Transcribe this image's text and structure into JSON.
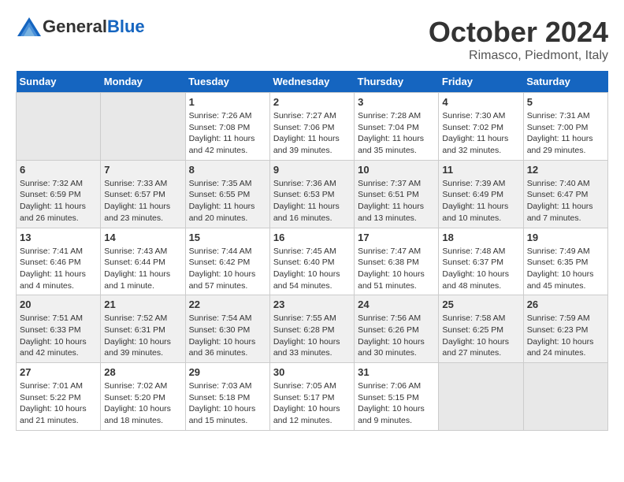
{
  "header": {
    "logo_line1": "General",
    "logo_line2": "Blue",
    "month": "October 2024",
    "location": "Rimasco, Piedmont, Italy"
  },
  "weekdays": [
    "Sunday",
    "Monday",
    "Tuesday",
    "Wednesday",
    "Thursday",
    "Friday",
    "Saturday"
  ],
  "weeks": [
    [
      {
        "day": "",
        "sunrise": "",
        "sunset": "",
        "daylight": ""
      },
      {
        "day": "",
        "sunrise": "",
        "sunset": "",
        "daylight": ""
      },
      {
        "day": "1",
        "sunrise": "Sunrise: 7:26 AM",
        "sunset": "Sunset: 7:08 PM",
        "daylight": "Daylight: 11 hours and 42 minutes."
      },
      {
        "day": "2",
        "sunrise": "Sunrise: 7:27 AM",
        "sunset": "Sunset: 7:06 PM",
        "daylight": "Daylight: 11 hours and 39 minutes."
      },
      {
        "day": "3",
        "sunrise": "Sunrise: 7:28 AM",
        "sunset": "Sunset: 7:04 PM",
        "daylight": "Daylight: 11 hours and 35 minutes."
      },
      {
        "day": "4",
        "sunrise": "Sunrise: 7:30 AM",
        "sunset": "Sunset: 7:02 PM",
        "daylight": "Daylight: 11 hours and 32 minutes."
      },
      {
        "day": "5",
        "sunrise": "Sunrise: 7:31 AM",
        "sunset": "Sunset: 7:00 PM",
        "daylight": "Daylight: 11 hours and 29 minutes."
      }
    ],
    [
      {
        "day": "6",
        "sunrise": "Sunrise: 7:32 AM",
        "sunset": "Sunset: 6:59 PM",
        "daylight": "Daylight: 11 hours and 26 minutes."
      },
      {
        "day": "7",
        "sunrise": "Sunrise: 7:33 AM",
        "sunset": "Sunset: 6:57 PM",
        "daylight": "Daylight: 11 hours and 23 minutes."
      },
      {
        "day": "8",
        "sunrise": "Sunrise: 7:35 AM",
        "sunset": "Sunset: 6:55 PM",
        "daylight": "Daylight: 11 hours and 20 minutes."
      },
      {
        "day": "9",
        "sunrise": "Sunrise: 7:36 AM",
        "sunset": "Sunset: 6:53 PM",
        "daylight": "Daylight: 11 hours and 16 minutes."
      },
      {
        "day": "10",
        "sunrise": "Sunrise: 7:37 AM",
        "sunset": "Sunset: 6:51 PM",
        "daylight": "Daylight: 11 hours and 13 minutes."
      },
      {
        "day": "11",
        "sunrise": "Sunrise: 7:39 AM",
        "sunset": "Sunset: 6:49 PM",
        "daylight": "Daylight: 11 hours and 10 minutes."
      },
      {
        "day": "12",
        "sunrise": "Sunrise: 7:40 AM",
        "sunset": "Sunset: 6:47 PM",
        "daylight": "Daylight: 11 hours and 7 minutes."
      }
    ],
    [
      {
        "day": "13",
        "sunrise": "Sunrise: 7:41 AM",
        "sunset": "Sunset: 6:46 PM",
        "daylight": "Daylight: 11 hours and 4 minutes."
      },
      {
        "day": "14",
        "sunrise": "Sunrise: 7:43 AM",
        "sunset": "Sunset: 6:44 PM",
        "daylight": "Daylight: 11 hours and 1 minute."
      },
      {
        "day": "15",
        "sunrise": "Sunrise: 7:44 AM",
        "sunset": "Sunset: 6:42 PM",
        "daylight": "Daylight: 10 hours and 57 minutes."
      },
      {
        "day": "16",
        "sunrise": "Sunrise: 7:45 AM",
        "sunset": "Sunset: 6:40 PM",
        "daylight": "Daylight: 10 hours and 54 minutes."
      },
      {
        "day": "17",
        "sunrise": "Sunrise: 7:47 AM",
        "sunset": "Sunset: 6:38 PM",
        "daylight": "Daylight: 10 hours and 51 minutes."
      },
      {
        "day": "18",
        "sunrise": "Sunrise: 7:48 AM",
        "sunset": "Sunset: 6:37 PM",
        "daylight": "Daylight: 10 hours and 48 minutes."
      },
      {
        "day": "19",
        "sunrise": "Sunrise: 7:49 AM",
        "sunset": "Sunset: 6:35 PM",
        "daylight": "Daylight: 10 hours and 45 minutes."
      }
    ],
    [
      {
        "day": "20",
        "sunrise": "Sunrise: 7:51 AM",
        "sunset": "Sunset: 6:33 PM",
        "daylight": "Daylight: 10 hours and 42 minutes."
      },
      {
        "day": "21",
        "sunrise": "Sunrise: 7:52 AM",
        "sunset": "Sunset: 6:31 PM",
        "daylight": "Daylight: 10 hours and 39 minutes."
      },
      {
        "day": "22",
        "sunrise": "Sunrise: 7:54 AM",
        "sunset": "Sunset: 6:30 PM",
        "daylight": "Daylight: 10 hours and 36 minutes."
      },
      {
        "day": "23",
        "sunrise": "Sunrise: 7:55 AM",
        "sunset": "Sunset: 6:28 PM",
        "daylight": "Daylight: 10 hours and 33 minutes."
      },
      {
        "day": "24",
        "sunrise": "Sunrise: 7:56 AM",
        "sunset": "Sunset: 6:26 PM",
        "daylight": "Daylight: 10 hours and 30 minutes."
      },
      {
        "day": "25",
        "sunrise": "Sunrise: 7:58 AM",
        "sunset": "Sunset: 6:25 PM",
        "daylight": "Daylight: 10 hours and 27 minutes."
      },
      {
        "day": "26",
        "sunrise": "Sunrise: 7:59 AM",
        "sunset": "Sunset: 6:23 PM",
        "daylight": "Daylight: 10 hours and 24 minutes."
      }
    ],
    [
      {
        "day": "27",
        "sunrise": "Sunrise: 7:01 AM",
        "sunset": "Sunset: 5:22 PM",
        "daylight": "Daylight: 10 hours and 21 minutes."
      },
      {
        "day": "28",
        "sunrise": "Sunrise: 7:02 AM",
        "sunset": "Sunset: 5:20 PM",
        "daylight": "Daylight: 10 hours and 18 minutes."
      },
      {
        "day": "29",
        "sunrise": "Sunrise: 7:03 AM",
        "sunset": "Sunset: 5:18 PM",
        "daylight": "Daylight: 10 hours and 15 minutes."
      },
      {
        "day": "30",
        "sunrise": "Sunrise: 7:05 AM",
        "sunset": "Sunset: 5:17 PM",
        "daylight": "Daylight: 10 hours and 12 minutes."
      },
      {
        "day": "31",
        "sunrise": "Sunrise: 7:06 AM",
        "sunset": "Sunset: 5:15 PM",
        "daylight": "Daylight: 10 hours and 9 minutes."
      },
      {
        "day": "",
        "sunrise": "",
        "sunset": "",
        "daylight": ""
      },
      {
        "day": "",
        "sunrise": "",
        "sunset": "",
        "daylight": ""
      }
    ]
  ]
}
